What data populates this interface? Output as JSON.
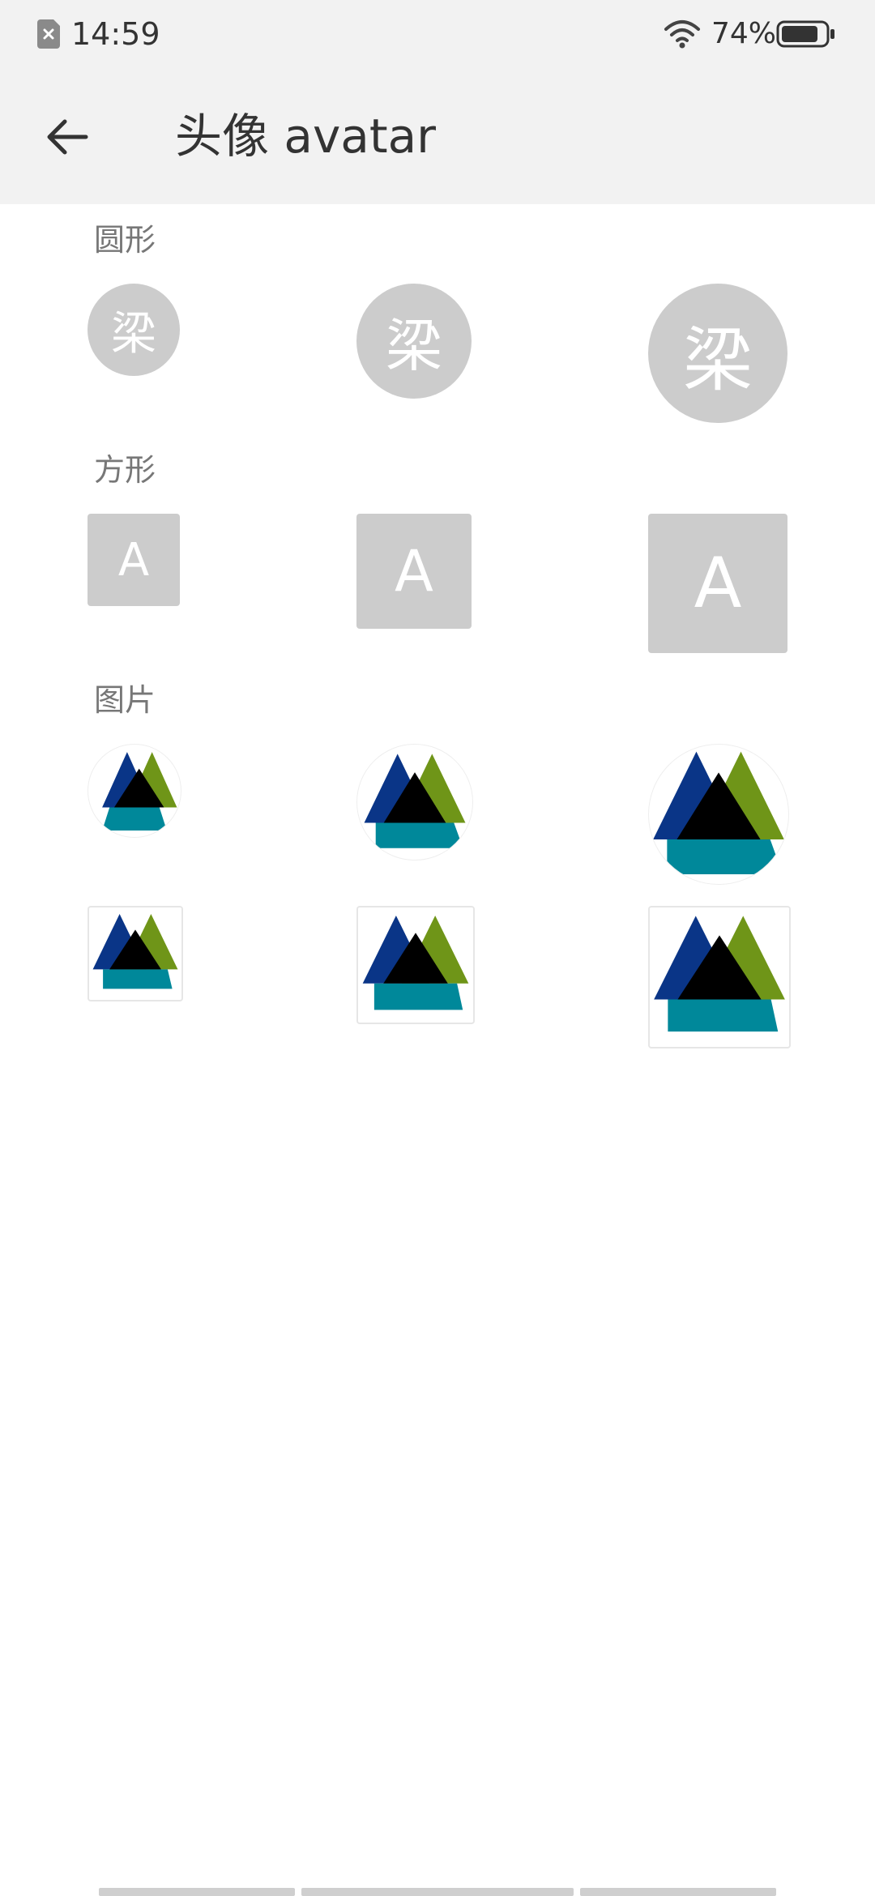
{
  "status_bar": {
    "time": "14:59",
    "battery": "74%",
    "icons": [
      "sim-error-icon",
      "wifi-icon",
      "battery-icon"
    ]
  },
  "app_bar": {
    "back_icon": "arrow-left-icon",
    "title": "头像 avatar"
  },
  "sections": {
    "circle": {
      "title": "圆形",
      "avatar_text": "梁"
    },
    "square": {
      "title": "方形",
      "avatar_text": "A"
    },
    "image": {
      "title": "图片",
      "image_icon": "triangle-logo-icon"
    }
  },
  "colors": {
    "background": "#ffffff",
    "header_bg": "#f2f2f2",
    "avatar_bg": "#cccccc",
    "avatar_text": "#ffffff",
    "logo_blue": "#0a3587",
    "logo_green": "#6f9518",
    "logo_teal": "#00889a",
    "logo_black": "#000000"
  }
}
